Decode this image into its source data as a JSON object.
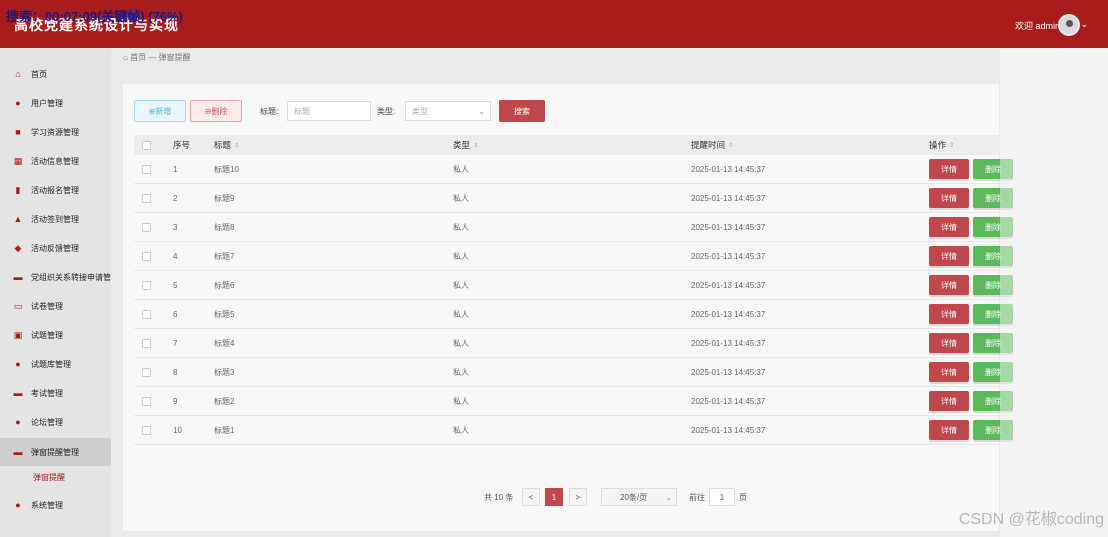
{
  "recording": "搜索：00:07:09(关键帧) (76%)",
  "header": {
    "title": "高校党建系统设计与实现",
    "welcome": "欢迎 admin"
  },
  "sidebar": {
    "items": [
      {
        "label": "首页",
        "icon": "home-icon"
      },
      {
        "label": "用户管理",
        "icon": "user-icon"
      },
      {
        "label": "学习资源管理",
        "icon": "book-icon"
      },
      {
        "label": "活动信息管理",
        "icon": "grid-icon"
      },
      {
        "label": "活动报名管理",
        "icon": "signup-icon"
      },
      {
        "label": "活动签到管理",
        "icon": "checkin-icon"
      },
      {
        "label": "活动反馈管理",
        "icon": "feedback-icon"
      },
      {
        "label": "党组织关系转接申请管理",
        "icon": "transfer-icon"
      },
      {
        "label": "试卷管理",
        "icon": "paper-icon"
      },
      {
        "label": "试题管理",
        "icon": "question-icon"
      },
      {
        "label": "试题库管理",
        "icon": "bank-icon"
      },
      {
        "label": "考试管理",
        "icon": "exam-icon"
      },
      {
        "label": "论坛管理",
        "icon": "forum-icon"
      },
      {
        "label": "弹窗提醒管理",
        "icon": "popup-icon"
      },
      {
        "label": "系统管理",
        "icon": "system-icon"
      }
    ],
    "submenu": {
      "label": "弹窗提醒"
    }
  },
  "breadcrumb": {
    "home": "首页",
    "sep": "—",
    "current": "弹窗提醒"
  },
  "toolbar": {
    "add": "⊕新增",
    "delete": "⊖删除",
    "title_label": "标题:",
    "title_placeholder": "标题",
    "type_label": "类型:",
    "type_placeholder": "类型",
    "search": "搜索"
  },
  "table": {
    "columns": [
      "序号",
      "标题",
      "类型",
      "提醒时间",
      "操作"
    ],
    "detail_label": "详情",
    "delete_label": "删除",
    "rows": [
      {
        "no": "1",
        "title": "标题10",
        "type": "私人",
        "time": "2025-01-13 14:45:37"
      },
      {
        "no": "2",
        "title": "标题9",
        "type": "私人",
        "time": "2025-01-13 14:45:37"
      },
      {
        "no": "3",
        "title": "标题8",
        "type": "私人",
        "time": "2025-01-13 14:45:37"
      },
      {
        "no": "4",
        "title": "标题7",
        "type": "私人",
        "time": "2025-01-13 14:45:37"
      },
      {
        "no": "5",
        "title": "标题6",
        "type": "私人",
        "time": "2025-01-13 14:45:37"
      },
      {
        "no": "6",
        "title": "标题5",
        "type": "私人",
        "time": "2025-01-13 14:45:37"
      },
      {
        "no": "7",
        "title": "标题4",
        "type": "私人",
        "time": "2025-01-13 14:45:37"
      },
      {
        "no": "8",
        "title": "标题3",
        "type": "私人",
        "time": "2025-01-13 14:45:37"
      },
      {
        "no": "9",
        "title": "标题2",
        "type": "私人",
        "time": "2025-01-13 14:45:37"
      },
      {
        "no": "10",
        "title": "标题1",
        "type": "私人",
        "time": "2025-01-13 14:45:37"
      }
    ]
  },
  "pagination": {
    "total": "共 10 条",
    "prev": "<",
    "current": "1",
    "next": ">",
    "page_size": "20条/页",
    "goto_label": "前往",
    "goto_value": "1",
    "page_unit": "页"
  },
  "watermark": "CSDN @花椒coding",
  "colors": {
    "primary": "#a91c1c",
    "danger": "#c0484c",
    "success": "#5cb85c",
    "info": "#4bb7d8"
  }
}
